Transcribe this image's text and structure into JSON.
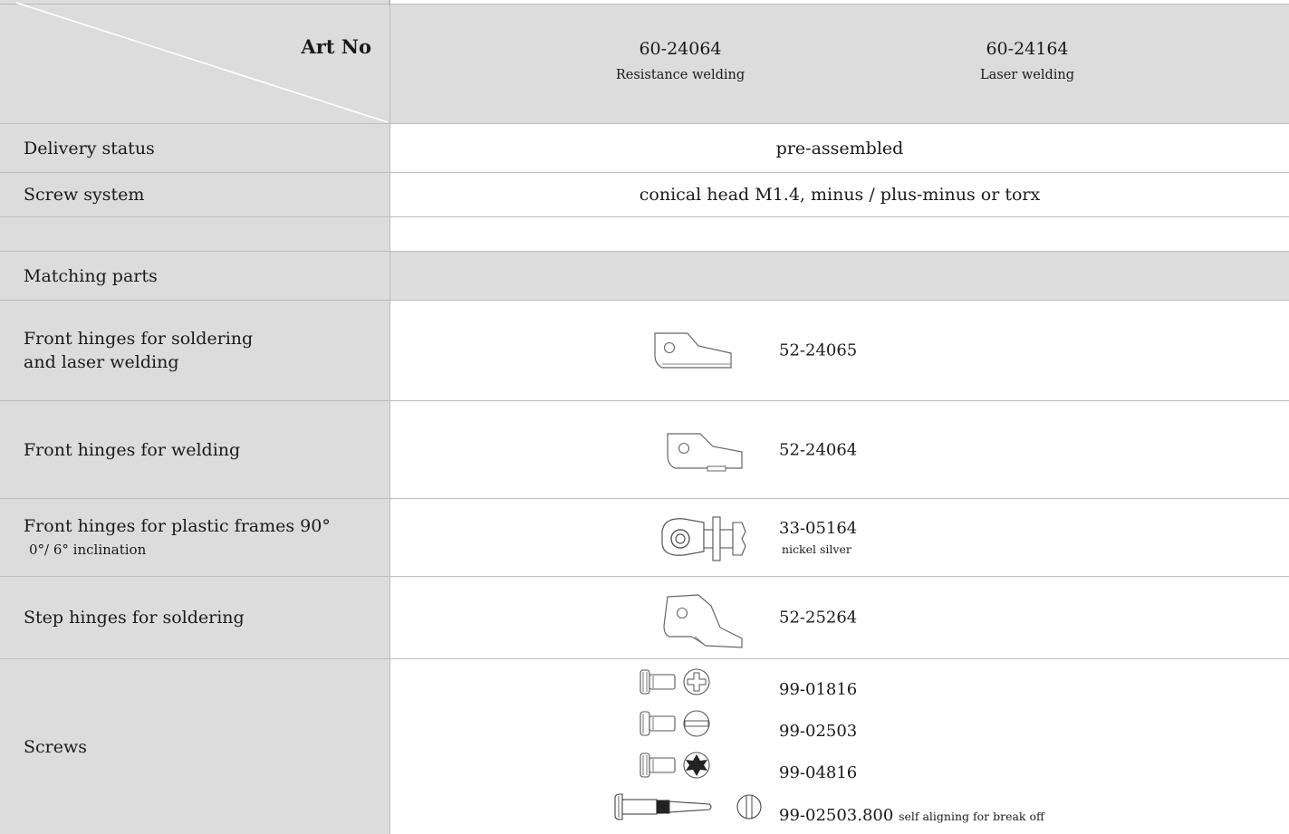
{
  "header": {
    "art_no_label": "Art No",
    "col1_code": "60-24064",
    "col1_sub": "Resistance welding",
    "col2_code": "60-24164",
    "col2_sub": "Laser welding"
  },
  "rows": {
    "delivery_label": "Delivery status",
    "delivery_value": "pre-assembled",
    "screw_system_label": "Screw system",
    "screw_system_value": "conical head M1.4, minus / plus-minus or torx",
    "matching_label": "Matching parts",
    "front_solder_label_1": "Front hinges for soldering",
    "front_solder_label_2": "and laser welding",
    "front_solder_part": "52-24065",
    "front_weld_label": "Front hinges for welding",
    "front_weld_part": "52-24064",
    "plastic_label_1": "Front hinges for plastic frames 90°",
    "plastic_label_2": "0°/ 6° inclination",
    "plastic_part": "33-05164",
    "plastic_part_sub": "nickel silver",
    "step_label": "Step hinges for soldering",
    "step_part": "52-25264",
    "screws_label": "Screws",
    "screw_parts": [
      "99-01816",
      "99-02503",
      "99-04816",
      "99-02503.800"
    ],
    "screw_last_note": "self aligning for break off"
  },
  "icons": {
    "front_solder": "hinge-plate-icon",
    "front_weld": "hinge-plate-icon",
    "plastic": "plastic-hinge-icon",
    "step": "step-hinge-icon",
    "screw_plus_minus": "screw-plus-minus-icon",
    "screw_minus": "screw-minus-icon",
    "screw_torx": "screw-torx-icon",
    "screw_break_off": "screw-break-off-icon"
  }
}
